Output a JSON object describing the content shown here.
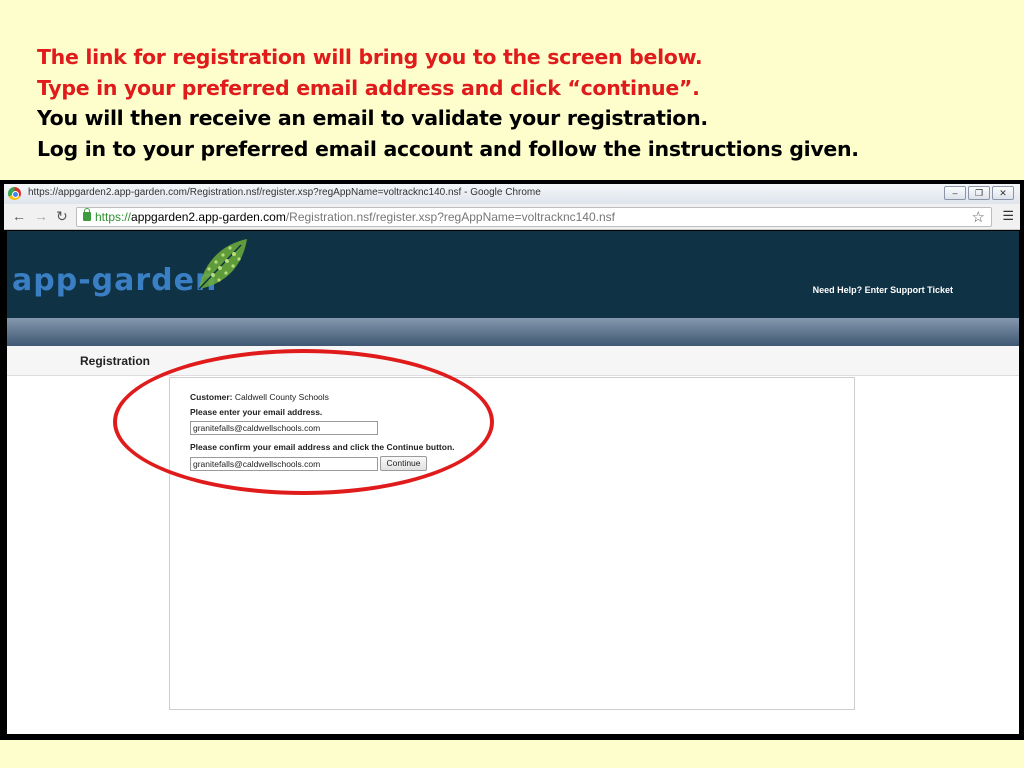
{
  "caption": {
    "line1": "The link for registration will bring you to the screen below.",
    "line2": "Type in your preferred email address and click “continue”.",
    "line3": "You will then receive an email to validate your registration.",
    "line4": "Log in to your preferred email account and follow the instructions given."
  },
  "browser": {
    "window_title": "https://appgarden2.app-garden.com/Registration.nsf/register.xsp?regAppName=voltracknc140.nsf - Google Chrome",
    "url_scheme": "https://",
    "url_host": "appgarden2.app-garden.com",
    "url_path": "/Registration.nsf/register.xsp?regAppName=voltracknc140.nsf",
    "icons": [
      "back-icon",
      "forward-icon",
      "reload-icon",
      "lock-icon",
      "star-icon",
      "menu-icon"
    ]
  },
  "site": {
    "logo_text_a": "app",
    "logo_text_b": "-",
    "logo_text_c": "garden",
    "help_link": "Need Help? Enter Support Ticket",
    "page_heading": "Registration",
    "header_color": "#0f3245",
    "logo_color": "#3a7fc4"
  },
  "form": {
    "customer_label": "Customer:",
    "customer_value": "Caldwell County Schools",
    "email_prompt": "Please enter your email address.",
    "email_value": "granitefalls@caldwellschools.com",
    "confirm_prompt": "Please confirm your email address and click the Continue button.",
    "confirm_value": "granitefalls@caldwellschools.com",
    "continue_label": "Continue"
  },
  "annotation_color": "#e01b1b"
}
